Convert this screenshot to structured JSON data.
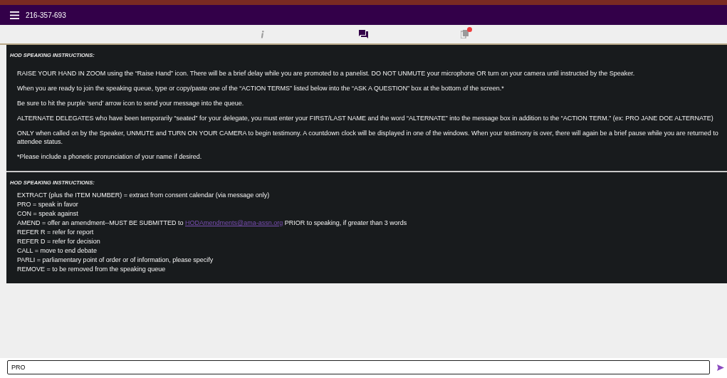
{
  "header": {
    "title": "216-357-693"
  },
  "tabs": [
    {
      "kind": "info",
      "selected": false,
      "notification": false
    },
    {
      "kind": "chat",
      "selected": true,
      "notification": false
    },
    {
      "kind": "documents",
      "selected": false,
      "notification": true
    }
  ],
  "panels": [
    {
      "heading": "HOD SPEAKING INSTRUCTIONS:",
      "spaced": true,
      "lines": [
        {
          "kind": "text",
          "text": "RAISE YOUR HAND IN ZOOM using the “Raise Hand” icon. There will be a brief delay while you are promoted to a panelist. DO NOT UNMUTE your microphone OR turn on your camera until instructed by the Speaker."
        },
        {
          "kind": "text",
          "text": "When you are ready to join the speaking queue, type or copy/paste one of the “ACTION TERMS” listed below into the “ASK A QUESTION” box at the bottom of the screen.*"
        },
        {
          "kind": "text",
          "text": "Be sure to hit the purple ‘send’ arrow icon to send your message into the queue."
        },
        {
          "kind": "text",
          "text": "ALTERNATE DELEGATES who have been temporarily “seated” for your delegate, you must enter your FIRST/LAST NAME and the word “ALTERNATE” into the message box in addition to the “ACTION TERM.” (ex: PRO JANE DOE ALTERNATE)"
        },
        {
          "kind": "text",
          "text": "ONLY when called on by the Speaker, UNMUTE and TURN ON YOUR CAMERA to begin testimony. A countdown clock will be displayed in one of the windows. When your testimony is over, there will again be a brief pause while you are returned to attendee status."
        },
        {
          "kind": "text",
          "text": "*Please include a phonetic pronunciation of your name if desired."
        }
      ]
    },
    {
      "heading": "HOD SPEAKING INSTRUCTIONS:",
      "spaced": false,
      "lines": [
        {
          "kind": "text",
          "text": "EXTRACT (plus the ITEM NUMBER) = extract from consent calendar (via message only)"
        },
        {
          "kind": "text",
          "text": "PRO = speak in favor"
        },
        {
          "kind": "text",
          "text": "CON = speak against"
        },
        {
          "kind": "link",
          "before": "AMEND = offer an amendment--MUST BE SUBMITTED to",
          "link": "HODAmendments@ama-assn.org",
          "after": "PRIOR to speaking, if greater than 3 words"
        },
        {
          "kind": "text",
          "text": "REFER R = refer for report"
        },
        {
          "kind": "text",
          "text": "REFER D = refer for decision"
        },
        {
          "kind": "text",
          "text": "CALL = move to end debate"
        },
        {
          "kind": "text",
          "text": "PARLI = parliamentary point of order or of information, please specify"
        },
        {
          "kind": "text",
          "text": "REMOVE = to be removed from the speaking queue"
        }
      ]
    }
  ],
  "message": {
    "value": "PRO"
  }
}
